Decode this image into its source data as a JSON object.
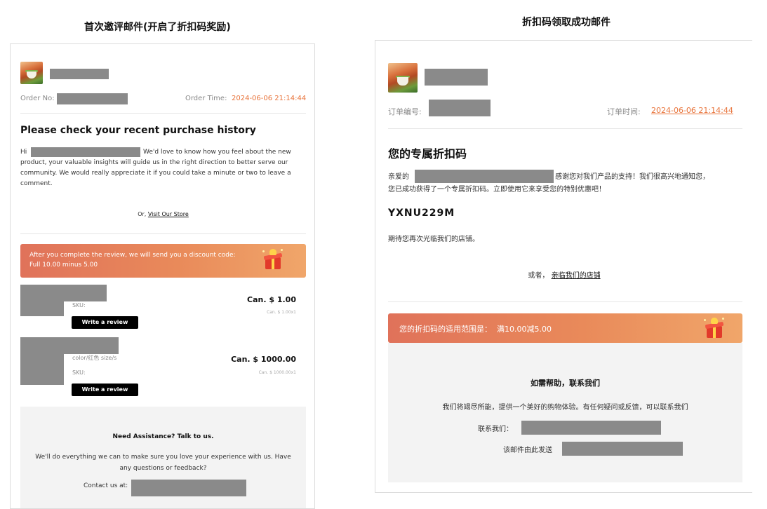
{
  "left": {
    "panel_title": "首次邀评邮件(开启了折扣码奖励)",
    "order_no_label": "Order No:",
    "order_time_label": "Order Time:",
    "order_time_value": "2024-06-06 21:14:44",
    "heading": "Please check your recent purchase history",
    "greeting": "Hi",
    "body_text_line1": "We'd love to know how you feel about the new",
    "body_text_rest": "product, your valuable insights will guide us in the right direction to better serve our community. We would really appreciate it if you could take a minute or two to leave a comment.",
    "or_text": "Or,",
    "visit_store": "Visit Our Store",
    "banner_line1": "After you complete the review, we will send you a discount code:",
    "banner_line2": "Full 10.00 minus 5.00",
    "products": [
      {
        "variant": "",
        "sku_label": "SKU:",
        "price": "Can. $ 1.00",
        "price_sub": "Can. $ 1.00x1",
        "button": "Write a review"
      },
      {
        "variant": "color/红色 size/s",
        "sku_label": "SKU:",
        "price": "Can. $ 1000.00",
        "price_sub": "Can. $ 1000.00x1",
        "button": "Write a review"
      }
    ],
    "assist_title": "Need Assistance? Talk to us.",
    "assist_text": "We'll do everything we can to make sure you love your experience with us. Have any questions or feedback?",
    "contact_label": "Contact us at:"
  },
  "right": {
    "panel_title": "折扣码领取成功邮件",
    "order_no_label": "订单编号:",
    "order_time_label": "订单时间:",
    "order_time_value": "2024-06-06 21:14:44",
    "heading": "您的专属折扣码",
    "greeting": "亲爱的",
    "body_text_line1": "感谢您对我们产品的支持！我们很高兴地通知您，",
    "body_text_line2": "您已成功获得了一个专属折扣码。立即使用它来享受您的特别优惠吧！",
    "discount_code": "YXNU229M",
    "closing": "期待您再次光临我们的店铺。",
    "or_text": "或者，",
    "visit_store": "亲临我们的店铺",
    "banner_text": "您的折扣码的适用范围是：  满10.00减5.00",
    "help_title": "如需帮助，联系我们",
    "help_text": "我们将竭尽所能，提供一个美好的购物体验。有任何疑问或反馈，可以联系我们",
    "contact_label": "联系我们：",
    "sent_from_label": "该邮件由此发送"
  },
  "colors": {
    "accent": "#e8733a",
    "banner_start": "#e0725a",
    "banner_end": "#f0a66a",
    "mask": "#8a8a8a"
  }
}
